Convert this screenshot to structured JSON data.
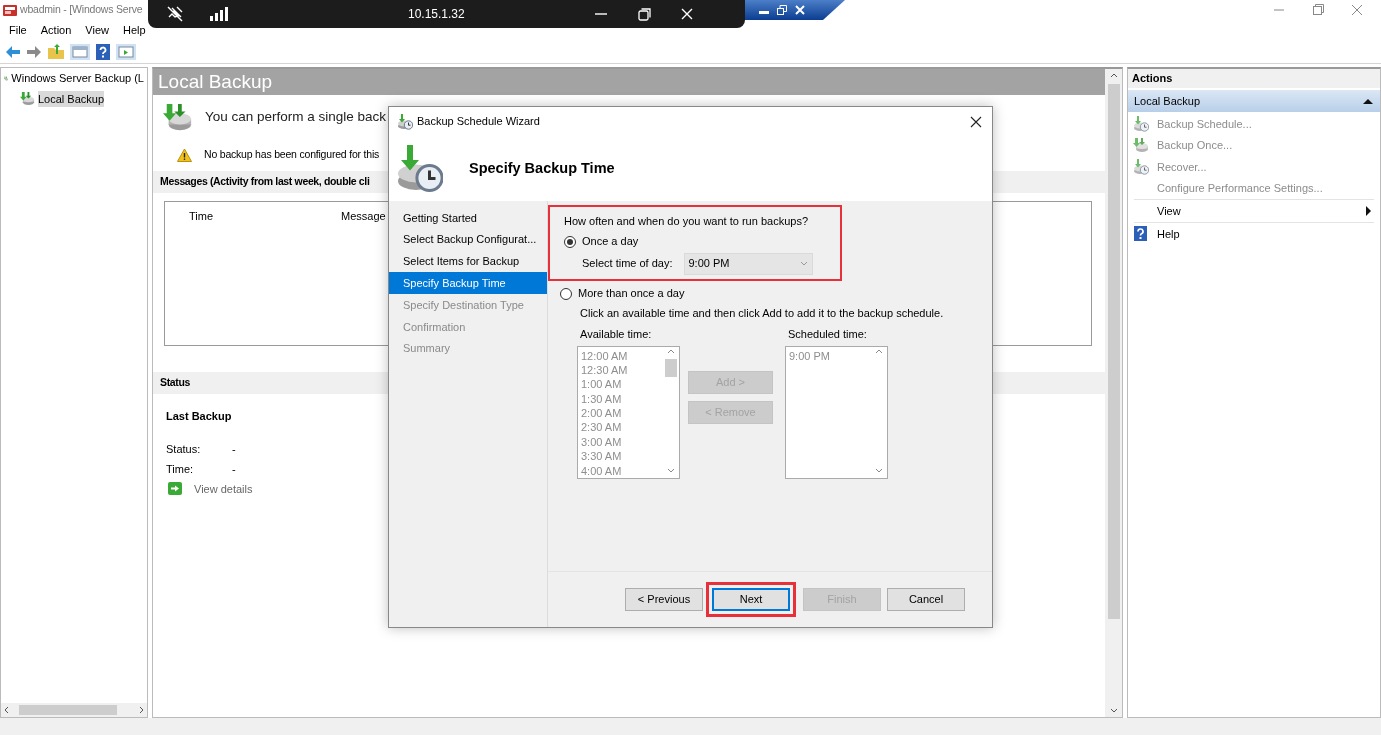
{
  "window": {
    "title": "wbadmin - [Windows Serve"
  },
  "remote_bar": {
    "address": "10.15.1.32"
  },
  "menu": [
    "File",
    "Action",
    "View",
    "Help"
  ],
  "tree": [
    {
      "label": "Windows Server Backup (L",
      "selected": false,
      "children": [
        {
          "label": "Local Backup",
          "selected": true
        }
      ]
    }
  ],
  "main": {
    "heading": "Local Backup",
    "intro": "You can perform a single back",
    "warning": "No backup has been configured for this",
    "messages_title": "Messages (Activity from last week, double cli",
    "columns": [
      "Time",
      "Message"
    ],
    "status_title": "Status",
    "last_backup_title": "Last Backup",
    "fields": [
      {
        "label": "Status:",
        "value": "-"
      },
      {
        "label": "Time:",
        "value": "-"
      }
    ],
    "link": "View details"
  },
  "actions": {
    "title": "Actions",
    "section": {
      "label": "Local Backup",
      "expanded": true
    },
    "items": [
      {
        "label": "Backup Schedule...",
        "kind": "schedule",
        "disabled": true
      },
      {
        "label": "Backup Once...",
        "kind": "backup",
        "disabled": true
      },
      {
        "label": "Recover...",
        "kind": "recover",
        "disabled": true
      },
      {
        "label": "Configure Performance Settings...",
        "kind": "plain",
        "disabled": true
      },
      {
        "label": "View",
        "kind": "submenu",
        "disabled": false
      },
      {
        "label": "Help",
        "kind": "help",
        "disabled": false
      }
    ]
  },
  "wizard": {
    "title": "Backup Schedule Wizard",
    "heading": "Specify Backup Time",
    "steps": [
      {
        "label": "Getting Started",
        "selected": false,
        "disabled": false
      },
      {
        "label": "Select Backup Configurat...",
        "selected": false,
        "disabled": false
      },
      {
        "label": "Select Items for Backup",
        "selected": false,
        "disabled": false
      },
      {
        "label": "Specify Backup Time",
        "selected": true,
        "disabled": false
      },
      {
        "label": "Specify Destination Type",
        "selected": false,
        "disabled": true
      },
      {
        "label": "Confirmation",
        "selected": false,
        "disabled": true
      },
      {
        "label": "Summary",
        "selected": false,
        "disabled": true
      }
    ],
    "question": "How often and when do you want to run backups?",
    "question_highlighted": true,
    "options": [
      {
        "label": "Once a day",
        "selected": true
      },
      {
        "label": "More than once a day",
        "selected": false
      }
    ],
    "time_label": "Select time of day:",
    "time_value": "9:00 PM",
    "hint": "Click an available time and then click Add to add it to the backup schedule.",
    "available_label": "Available time:",
    "available": [
      "12:00 AM",
      "12:30 AM",
      "1:00 AM",
      "1:30 AM",
      "2:00 AM",
      "2:30 AM",
      "3:00 AM",
      "3:30 AM",
      "4:00 AM"
    ],
    "scheduled_label": "Scheduled time:",
    "scheduled": [
      "9:00 PM"
    ],
    "list_buttons": [
      {
        "label": "Add >",
        "disabled": true
      },
      {
        "label": "< Remove",
        "disabled": true
      }
    ],
    "buttons": [
      {
        "label": "< Previous",
        "disabled": false,
        "focused": false,
        "highlighted": false
      },
      {
        "label": "Next",
        "disabled": false,
        "focused": true,
        "highlighted": true
      },
      {
        "label": "Finish",
        "disabled": true,
        "focused": false,
        "highlighted": false
      },
      {
        "label": "Cancel",
        "disabled": false,
        "focused": false,
        "highlighted": false
      }
    ]
  }
}
